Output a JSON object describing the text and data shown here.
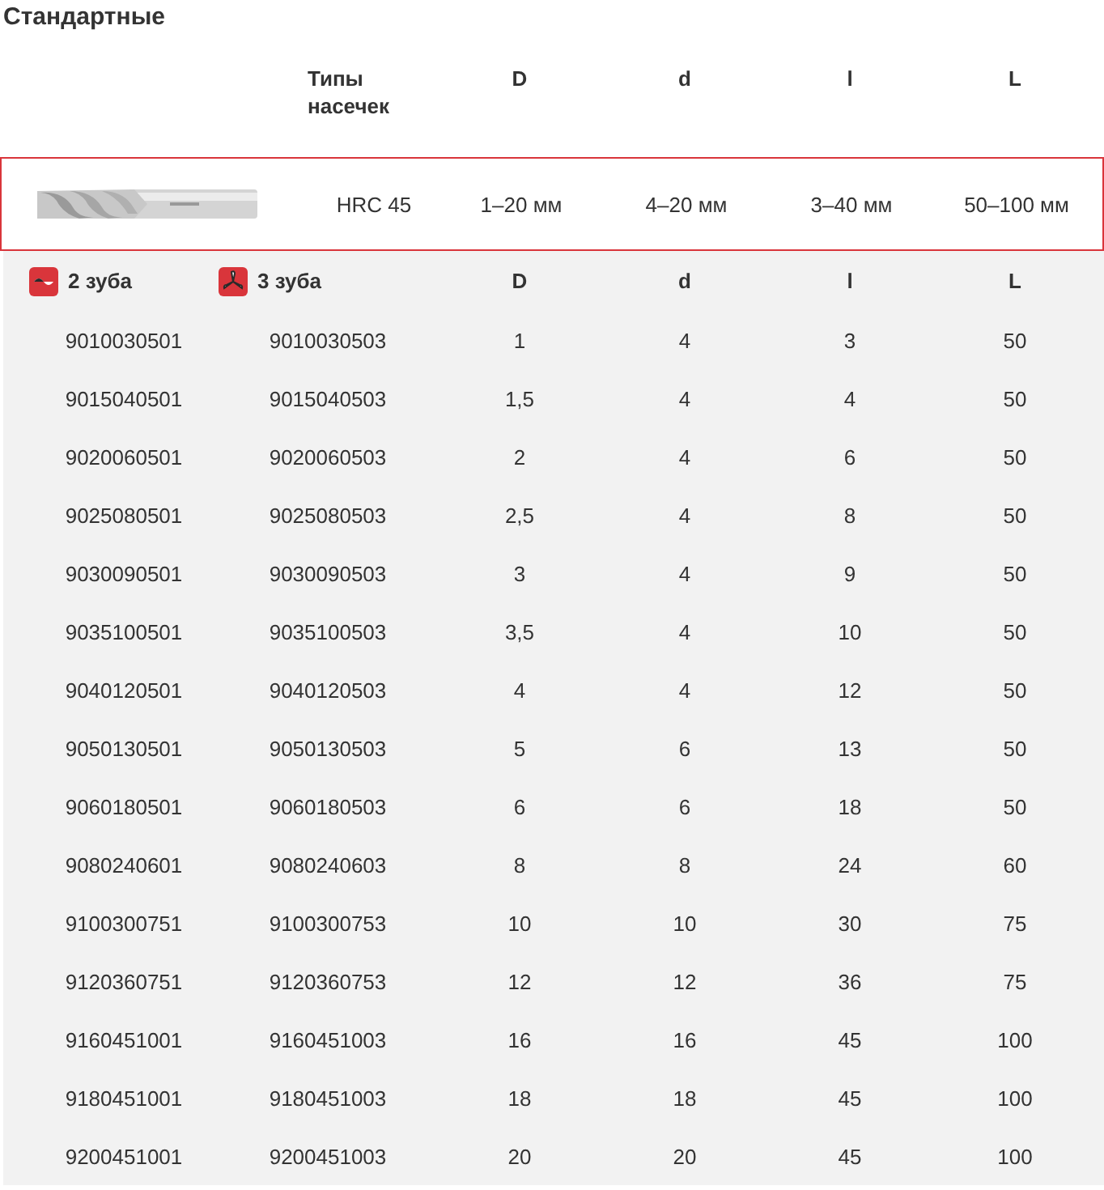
{
  "title": "Стандартные",
  "spec_header": [
    "Типы насечек",
    "D",
    "d",
    "l",
    "L"
  ],
  "product": {
    "kind": "picture",
    "cells": [
      "HRC 45",
      "1–20 мм",
      "4–20 мм",
      "3–40 мм",
      "50–100 мм"
    ]
  },
  "table": {
    "columns": [
      "2 зуба",
      "3 зуба",
      "D",
      "d",
      "l",
      "L"
    ],
    "rows": [
      [
        "9010030501",
        "9010030503",
        "1",
        "4",
        "3",
        "50"
      ],
      [
        "9015040501",
        "9015040503",
        "1,5",
        "4",
        "4",
        "50"
      ],
      [
        "9020060501",
        "9020060503",
        "2",
        "4",
        "6",
        "50"
      ],
      [
        "9025080501",
        "9025080503",
        "2,5",
        "4",
        "8",
        "50"
      ],
      [
        "9030090501",
        "9030090503",
        "3",
        "4",
        "9",
        "50"
      ],
      [
        "9035100501",
        "9035100503",
        "3,5",
        "4",
        "10",
        "50"
      ],
      [
        "9040120501",
        "9040120503",
        "4",
        "4",
        "12",
        "50"
      ],
      [
        "9050130501",
        "9050130503",
        "5",
        "6",
        "13",
        "50"
      ],
      [
        "9060180501",
        "9060180503",
        "6",
        "6",
        "18",
        "50"
      ],
      [
        "9080240601",
        "9080240603",
        "8",
        "8",
        "24",
        "60"
      ],
      [
        "9100300751",
        "9100300753",
        "10",
        "10",
        "30",
        "75"
      ],
      [
        "9120360751",
        "9120360753",
        "12",
        "12",
        "36",
        "75"
      ],
      [
        "9160451001",
        "9160451003",
        "16",
        "16",
        "45",
        "100"
      ],
      [
        "9180451001",
        "9180451003",
        "18",
        "18",
        "45",
        "100"
      ],
      [
        "9200451001",
        "9200451003",
        "20",
        "20",
        "45",
        "100"
      ]
    ]
  }
}
